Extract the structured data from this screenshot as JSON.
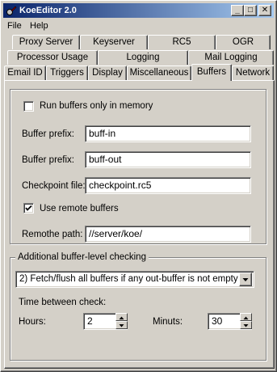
{
  "window": {
    "title": "KoeEditor 2.0",
    "controls": {
      "minimize": "_",
      "maximize": "□",
      "close": "✕"
    }
  },
  "menu": [
    "File",
    "Help"
  ],
  "tabs": {
    "row1": [
      "Proxy Server",
      "Keyserver",
      "RC5",
      "OGR"
    ],
    "row2": [
      "Processor Usage",
      "Logging",
      "Mail Logging"
    ],
    "row3": [
      "Email ID",
      "Triggers",
      "Display",
      "Miscellaneous",
      "Buffers",
      "Network"
    ],
    "active": "Buffers"
  },
  "buffers": {
    "run_in_memory": {
      "label": "Run buffers only in memory",
      "checked": false
    },
    "in_prefix": {
      "label": "Buffer prefix:",
      "value": "buff-in"
    },
    "out_prefix": {
      "label": "Buffer prefix:",
      "value": "buff-out"
    },
    "checkpoint": {
      "label": "Checkpoint file:",
      "value": "checkpoint.rc5"
    },
    "use_remote": {
      "label": "Use remote buffers",
      "checked": true
    },
    "remote_path": {
      "label": "Remothe path:",
      "value": "//server/koe/"
    }
  },
  "checking": {
    "caption": "Additional buffer-level checking",
    "mode": "2) Fetch/flush all buffers if any out-buffer is not empty",
    "time_label": "Time between check:",
    "hours": {
      "label": "Hours:",
      "value": "2"
    },
    "minutes": {
      "label": "Minuts:",
      "value": "30"
    }
  }
}
